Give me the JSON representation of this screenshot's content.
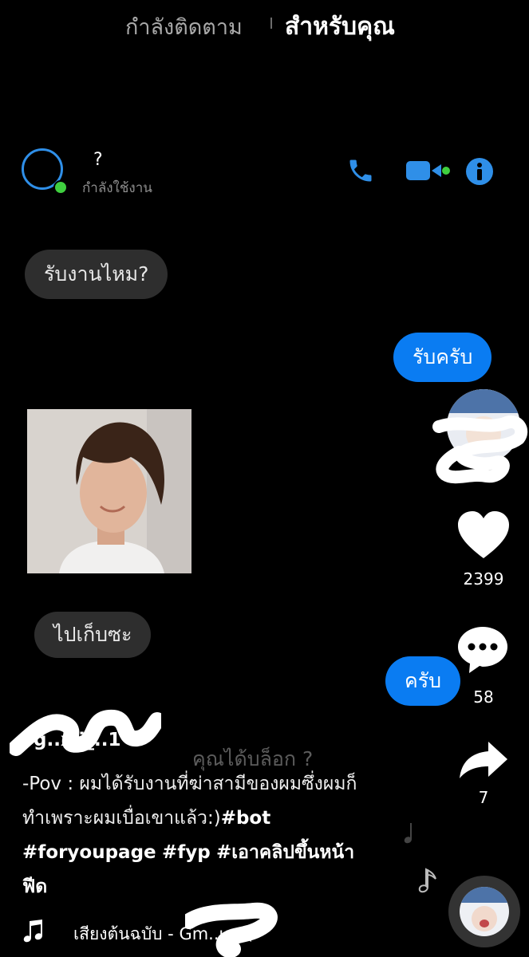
{
  "top_tabs": {
    "following": "กำลังติดตาม",
    "for_you": "สำหรับคุณ"
  },
  "chat": {
    "contact_name": "?",
    "status": "กำลังใช้งาน",
    "messages": [
      {
        "side": "in",
        "text": "รับงานไหม?"
      },
      {
        "side": "out",
        "text": "รับครับ"
      },
      {
        "side": "in",
        "text": "ไปเก็บซะ"
      },
      {
        "side": "out",
        "text": "ครับ"
      }
    ],
    "blocked_notice": "คุณได้บล็อก ?"
  },
  "rail": {
    "likes": "2399",
    "comments": "58",
    "shares": "7"
  },
  "post": {
    "username": "g..xii_..1",
    "caption_text": "-Pov : ผมได้รับงานที่ฆ่าสามีของผมซึ่งผมก็ทำเพราะผมเบื่อเขาแล้ว:)",
    "hashtags": [
      "#bot",
      "#foryoupage",
      "#fyp",
      "#เอาคลิปขึ้นหน้าฟีด"
    ],
    "music": "เสียงต้นฉบับ - Gm..u - (",
    "icons": [
      "music-note-icon",
      "heart-icon",
      "comment-icon",
      "share-icon",
      "phone-icon",
      "video-camera-icon",
      "info-icon"
    ]
  },
  "colors": {
    "accent": "#0a7cf2",
    "incoming_bubble": "#2e2e2e",
    "online": "#3fcf3f"
  }
}
